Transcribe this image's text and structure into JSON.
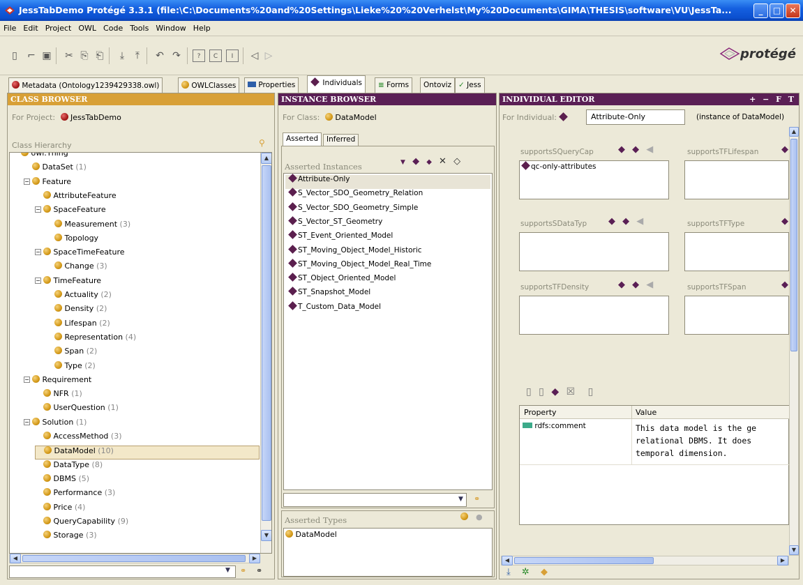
{
  "window": {
    "title": "JessTabDemo  Protégé 3.3.1     (file:\\C:\\Documents%20and%20Settings\\Lieke%20%20Verhelst\\My%20Documents\\GIMA\\THESIS\\software\\VU\\JessTa..."
  },
  "menu": [
    "File",
    "Edit",
    "Project",
    "OWL",
    "Code",
    "Tools",
    "Window",
    "Help"
  ],
  "logo": "protégé",
  "tabs": [
    {
      "label": "Metadata (Ontology1239429338.owl)"
    },
    {
      "label": "OWLClasses"
    },
    {
      "label": "Properties"
    },
    {
      "label": "Individuals"
    },
    {
      "label": "Forms"
    },
    {
      "label": "Ontoviz"
    },
    {
      "label": "Jess"
    }
  ],
  "class_browser": {
    "header": "CLASS BROWSER",
    "for_project_label": "For Project:",
    "project": "JessTabDemo",
    "hierarchy_label": "Class Hierarchy",
    "items": [
      {
        "label": "owl:Thing",
        "count": ""
      },
      {
        "label": "DataSet",
        "count": "(1)"
      },
      {
        "label": "Feature",
        "count": ""
      },
      {
        "label": "AttributeFeature",
        "count": ""
      },
      {
        "label": "SpaceFeature",
        "count": ""
      },
      {
        "label": "Measurement",
        "count": "(3)"
      },
      {
        "label": "Topology",
        "count": ""
      },
      {
        "label": "SpaceTimeFeature",
        "count": ""
      },
      {
        "label": "Change",
        "count": "(3)"
      },
      {
        "label": "TimeFeature",
        "count": ""
      },
      {
        "label": "Actuality",
        "count": "(2)"
      },
      {
        "label": "Density",
        "count": "(2)"
      },
      {
        "label": "Lifespan",
        "count": "(2)"
      },
      {
        "label": "Representation",
        "count": "(4)"
      },
      {
        "label": "Span",
        "count": "(2)"
      },
      {
        "label": "Type",
        "count": "(2)"
      },
      {
        "label": "Requirement",
        "count": ""
      },
      {
        "label": "NFR",
        "count": "(1)"
      },
      {
        "label": "UserQuestion",
        "count": "(1)"
      },
      {
        "label": "Solution",
        "count": "(1)"
      },
      {
        "label": "AccessMethod",
        "count": "(3)"
      },
      {
        "label": "DataModel",
        "count": "(10)"
      },
      {
        "label": "DataType",
        "count": "(8)"
      },
      {
        "label": "DBMS",
        "count": "(5)"
      },
      {
        "label": "Performance",
        "count": "(3)"
      },
      {
        "label": "Price",
        "count": "(4)"
      },
      {
        "label": "QueryCapability",
        "count": "(9)"
      },
      {
        "label": "Storage",
        "count": "(3)"
      }
    ]
  },
  "instance_browser": {
    "header": "INSTANCE BROWSER",
    "for_class_label": "For Class:",
    "class": "DataModel",
    "tab_asserted": "Asserted",
    "tab_inferred": "Inferred",
    "instances_label": "Asserted Instances",
    "instances": [
      "Attribute-Only",
      "S_Vector_SDO_Geometry_Relation",
      "S_Vector_SDO_Geometry_Simple",
      "S_Vector_ST_Geometry",
      "ST_Event_Oriented_Model",
      "ST_Moving_Object_Model_Historic",
      "ST_Moving_Object_Model_Real_Time",
      "ST_Object_Oriented_Model",
      "ST_Snapshot_Model",
      "T_Custom_Data_Model"
    ],
    "types_label": "Asserted Types",
    "types": [
      "DataModel"
    ]
  },
  "individual_editor": {
    "header": "INDIVIDUAL EDITOR",
    "header_controls": "+ − F T",
    "for_individual_label": "For Individual:",
    "individual": "Attribute-Only",
    "instance_of": "(instance of DataModel)",
    "slots": [
      {
        "label": "supportsSQueryCap",
        "values": [
          "qc-only-attributes"
        ]
      },
      {
        "label": "supportsTFLifespan",
        "values": []
      },
      {
        "label": "supportsSDataTyp",
        "values": []
      },
      {
        "label": "supportsTFType",
        "values": []
      },
      {
        "label": "supportsTFDensity",
        "values": []
      },
      {
        "label": "supportsTFSpan",
        "values": []
      }
    ],
    "table_headers": [
      "Property",
      "Value"
    ],
    "table_rows": [
      {
        "property": "rdfs:comment",
        "value_lines": [
          "This data model is the ge",
          "relational DBMS. It does",
          "temporal dimension."
        ]
      }
    ]
  }
}
